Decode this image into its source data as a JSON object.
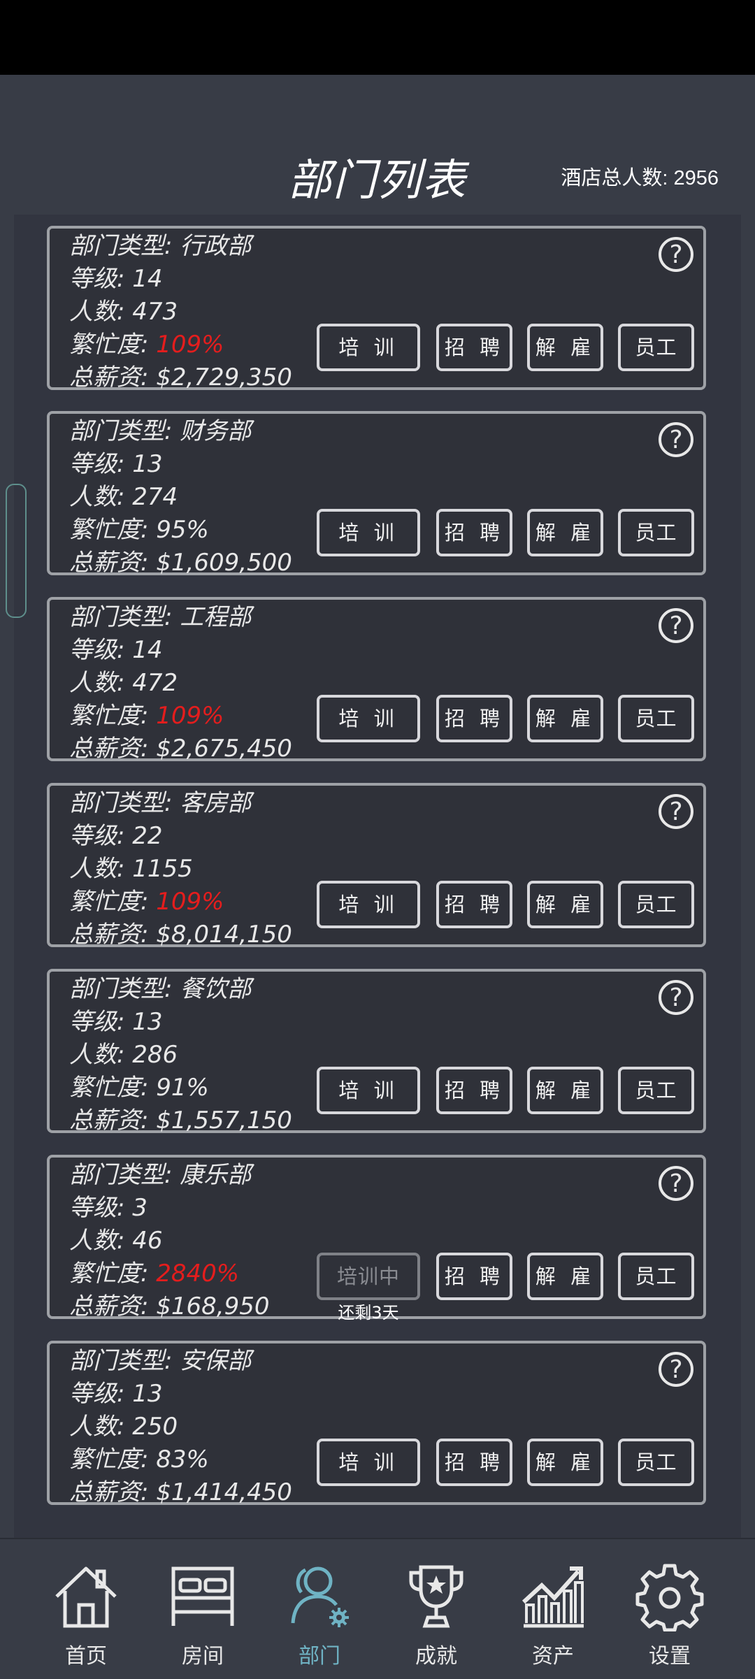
{
  "header": {
    "title": "部门列表",
    "total_label": "酒店总人数: 2956"
  },
  "buttons": {
    "train": "培 训",
    "training": "培训中",
    "hire": "招 聘",
    "fire": "解 雇",
    "staff": "员工",
    "help": "?"
  },
  "departments": [
    {
      "type": "部门类型: 行政部",
      "level": "等级: 14",
      "count": "人数: 473",
      "busy_label": "繁忙度: ",
      "busy": "109%",
      "busy_over": true,
      "salary": "总薪资: $2,729,350"
    },
    {
      "type": "部门类型: 财务部",
      "level": "等级: 13",
      "count": "人数: 274",
      "busy_label": "繁忙度: ",
      "busy": "95%",
      "busy_over": false,
      "salary": "总薪资: $1,609,500"
    },
    {
      "type": "部门类型: 工程部",
      "level": "等级: 14",
      "count": "人数: 472",
      "busy_label": "繁忙度: ",
      "busy": "109%",
      "busy_over": true,
      "salary": "总薪资: $2,675,450"
    },
    {
      "type": "部门类型: 客房部",
      "level": "等级: 22",
      "count": "人数: 1155",
      "busy_label": "繁忙度: ",
      "busy": "109%",
      "busy_over": true,
      "salary": "总薪资: $8,014,150"
    },
    {
      "type": "部门类型: 餐饮部",
      "level": "等级: 13",
      "count": "人数: 286",
      "busy_label": "繁忙度: ",
      "busy": "91%",
      "busy_over": false,
      "salary": "总薪资: $1,557,150"
    },
    {
      "type": "部门类型: 康乐部",
      "level": "等级: 3",
      "count": "人数: 46",
      "busy_label": "繁忙度: ",
      "busy": "2840%",
      "busy_over": true,
      "salary": "总薪资: $168,950",
      "training": true,
      "remaining": "还剩3天"
    },
    {
      "type": "部门类型: 安保部",
      "level": "等级: 13",
      "count": "人数: 250",
      "busy_label": "繁忙度: ",
      "busy": "83%",
      "busy_over": false,
      "salary": "总薪资: $1,414,450"
    }
  ],
  "tabbar": [
    {
      "label": "首页",
      "icon": "home-icon",
      "active": false
    },
    {
      "label": "房间",
      "icon": "bed-icon",
      "active": false
    },
    {
      "label": "部门",
      "icon": "staff-gear-icon",
      "active": true
    },
    {
      "label": "成就",
      "icon": "trophy-icon",
      "active": false
    },
    {
      "label": "资产",
      "icon": "chart-icon",
      "active": false
    },
    {
      "label": "设置",
      "icon": "gear-icon",
      "active": false
    }
  ],
  "colors": {
    "background": "#383c46",
    "card": "#2f3139",
    "alert": "#e41d1d",
    "accent": "#6fb3c4"
  }
}
